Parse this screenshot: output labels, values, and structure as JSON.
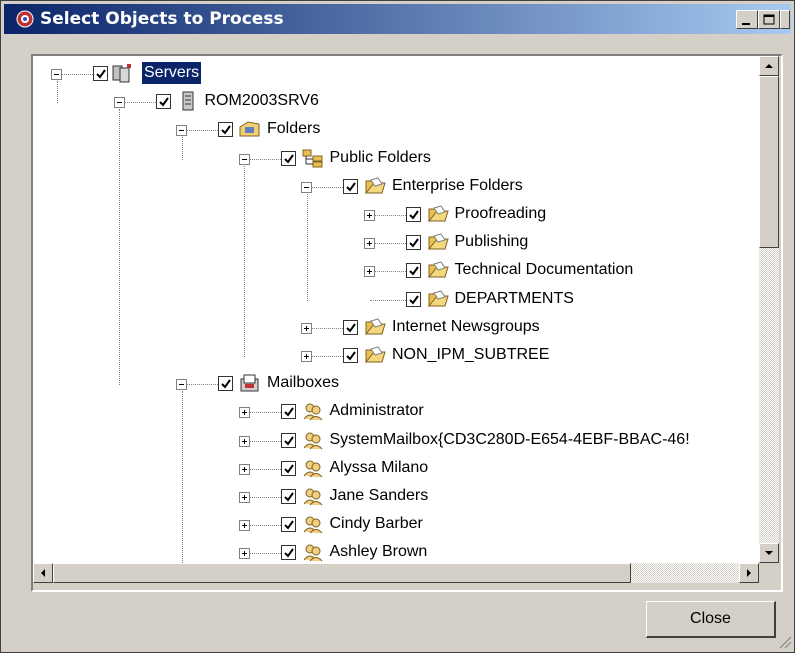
{
  "window": {
    "title": "Select Objects to Process"
  },
  "tree": {
    "nodes": [
      {
        "label": "Servers"
      },
      {
        "label": "ROM2003SRV6"
      },
      {
        "label": "Folders"
      },
      {
        "label": "Public Folders"
      },
      {
        "label": "Enterprise Folders"
      },
      {
        "label": "Proofreading"
      },
      {
        "label": "Publishing"
      },
      {
        "label": "Technical Documentation"
      },
      {
        "label": "DEPARTMENTS"
      },
      {
        "label": "Internet Newsgroups"
      },
      {
        "label": "NON_IPM_SUBTREE"
      },
      {
        "label": "Mailboxes"
      },
      {
        "label": "Administrator"
      },
      {
        "label": "SystemMailbox{CD3C280D-E654-4EBF-BBAC-46!"
      },
      {
        "label": "Alyssa Milano"
      },
      {
        "label": "Jane Sanders"
      },
      {
        "label": "Cindy Barber"
      },
      {
        "label": "Ashley Brown"
      }
    ]
  },
  "buttons": {
    "close": "Close"
  },
  "colors": {
    "titlebar": "#0a246a",
    "selection": "#0a246a",
    "face": "#d4d0c8"
  }
}
